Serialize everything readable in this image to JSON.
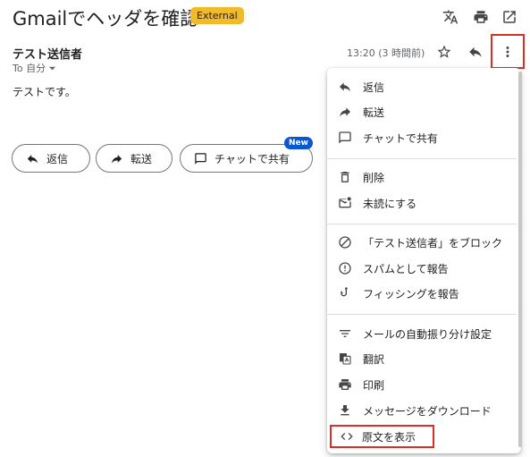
{
  "header": {
    "subject": "Gmailでヘッダを確認",
    "badge": "External",
    "toolbar_icons": [
      "translate-icon",
      "print-icon",
      "open-in-new-window-icon"
    ]
  },
  "message": {
    "sender": "テスト送信者",
    "recipient_label": "To 自分",
    "time": "13:20 (3 時間前)",
    "body": "テストです。"
  },
  "actions": {
    "reply": "返信",
    "forward": "転送",
    "chat_share": "チャットで共有",
    "new_badge": "New"
  },
  "menu": {
    "groups": [
      [
        {
          "label": "返信",
          "icon": "reply-icon"
        },
        {
          "label": "転送",
          "icon": "forward-icon"
        },
        {
          "label": "チャットで共有",
          "icon": "chat-icon"
        }
      ],
      [
        {
          "label": "削除",
          "icon": "trash-icon"
        },
        {
          "label": "未読にする",
          "icon": "mark-unread-icon"
        }
      ],
      [
        {
          "label": "「テスト送信者」をブロック",
          "icon": "block-icon"
        },
        {
          "label": "スパムとして報告",
          "icon": "report-spam-icon"
        },
        {
          "label": "フィッシングを報告",
          "icon": "phishing-icon"
        }
      ],
      [
        {
          "label": "メールの自動振り分け設定",
          "icon": "filter-icon"
        },
        {
          "label": "翻訳",
          "icon": "translate-icon"
        },
        {
          "label": "印刷",
          "icon": "print-icon"
        },
        {
          "label": "メッセージをダウンロード",
          "icon": "download-icon"
        },
        {
          "label": "原文を表示",
          "icon": "code-icon"
        }
      ]
    ]
  },
  "colors": {
    "badge_bg": "#f1ba2b",
    "highlight_border": "#d93025",
    "new_badge_bg": "#0b57d0"
  }
}
